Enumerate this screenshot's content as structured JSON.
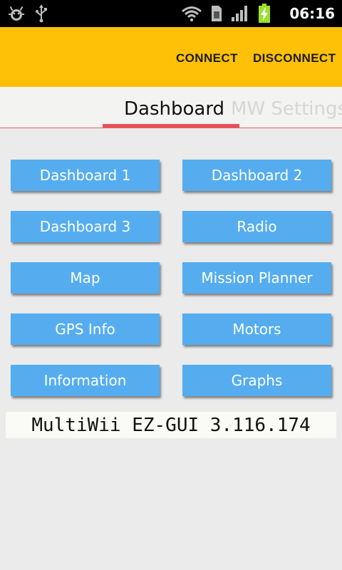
{
  "status_bar": {
    "time": "06:16",
    "icons": [
      "android-debug-icon",
      "usb-icon",
      "wifi-icon",
      "sim-icon",
      "signal-icon",
      "battery-charging-icon"
    ]
  },
  "action_bar": {
    "connect_label": "CONNECT",
    "disconnect_label": "DISCONNECT",
    "background_color": "#ffc107"
  },
  "tabs": [
    {
      "label": "Dashboard",
      "active": true
    },
    {
      "label": "MW Settings",
      "active": false
    }
  ],
  "buttons": [
    {
      "label": "Dashboard 1"
    },
    {
      "label": "Dashboard 2"
    },
    {
      "label": "Dashboard 3"
    },
    {
      "label": "Radio"
    },
    {
      "label": "Map"
    },
    {
      "label": "Mission Planner"
    },
    {
      "label": "GPS Info"
    },
    {
      "label": "Motors"
    },
    {
      "label": "Information"
    },
    {
      "label": "Graphs"
    }
  ],
  "button_color": "#55adf0",
  "version_text": "MultiWii EZ-GUI 3.116.174"
}
